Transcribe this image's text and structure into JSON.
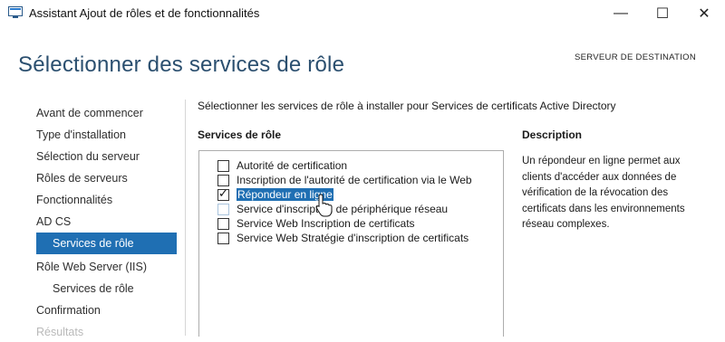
{
  "window": {
    "title": "Assistant Ajout de rôles et de fonctionnalités",
    "minimize_glyph": "—",
    "maximize_glyph": "☐",
    "close_glyph": "✕"
  },
  "header": {
    "title": "Sélectionner des services de rôle",
    "destination_label": "SERVEUR DE DESTINATION"
  },
  "nav": {
    "items": [
      {
        "label": "Avant de commencer",
        "state": "normal"
      },
      {
        "label": "Type d'installation",
        "state": "normal"
      },
      {
        "label": "Sélection du serveur",
        "state": "normal"
      },
      {
        "label": "Rôles de serveurs",
        "state": "normal"
      },
      {
        "label": "Fonctionnalités",
        "state": "normal"
      },
      {
        "label": "AD CS",
        "state": "normal"
      },
      {
        "label": "Services de rôle",
        "state": "active"
      },
      {
        "label": "Rôle Web Server (IIS)",
        "state": "normal"
      },
      {
        "label": "Services de rôle",
        "state": "normal"
      },
      {
        "label": "Confirmation",
        "state": "normal"
      },
      {
        "label": "Résultats",
        "state": "disabled"
      }
    ]
  },
  "main": {
    "instruction": "Sélectionner les services de rôle à installer pour Services de certificats Active Directory",
    "services_heading": "Services de rôle",
    "description_heading": "Description",
    "services": [
      {
        "label": "Autorité de certification",
        "checked": false
      },
      {
        "label": "Inscription de l'autorité de certification via le Web",
        "checked": false
      },
      {
        "label": "Répondeur en ligne",
        "checked": true,
        "selected": true
      },
      {
        "label": "Service d'inscription de périphérique réseau",
        "checked": false
      },
      {
        "label": "Service Web Inscription de certificats",
        "checked": false
      },
      {
        "label": "Service Web Stratégie d'inscription de certificats",
        "checked": false
      }
    ],
    "check_glyph": "✓",
    "description": "Un répondeur en ligne permet aux clients d'accéder aux données de vérification de la révocation des certificats dans les environnements réseau complexes."
  },
  "colors": {
    "accent": "#1f6fb3",
    "title": "#2b4f6f"
  }
}
